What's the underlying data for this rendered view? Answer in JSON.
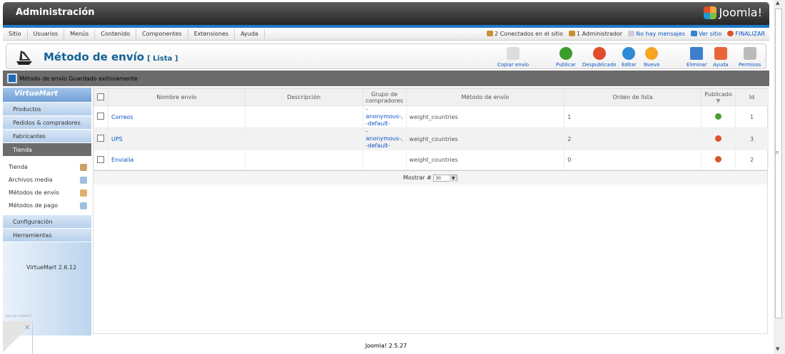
{
  "header": {
    "title": "Administración",
    "brand": "Joomla!"
  },
  "menu": [
    "Sitio",
    "Usuarios",
    "Menús",
    "Contenido",
    "Componentes",
    "Extensiones",
    "Ayuda"
  ],
  "status": {
    "online": "2 Conectados en el sitio",
    "admins": "1 Administrador",
    "messages": "No hay mensajes",
    "view_site": "Ver sitio",
    "logout": "FINALIZAR"
  },
  "page": {
    "title": "Método de envío",
    "subtitle": "[ Lista ]"
  },
  "toolbar": {
    "copy": "Copiar envío",
    "publish": "Publicar",
    "unpublish": "Despublicado",
    "edit": "Editar",
    "new": "Nuevo",
    "delete": "Eliminar",
    "help": "Ayuda",
    "permissions": "Permisos"
  },
  "message": "Método de envío Guardado exitosamente",
  "sidebar": {
    "logo": "VirtueMart",
    "sections": [
      "Productos",
      "Pedidos & compradores",
      "Fabricantes",
      "Tienda"
    ],
    "items": [
      "Tienda",
      "Archivos media",
      "Métodos de envío",
      "Métodos de pago"
    ],
    "sections2": [
      "Configuración",
      "Herramientas"
    ],
    "version": "VirtueMart 2.6.12",
    "built_by": "Joo by iceberit"
  },
  "table": {
    "headers": {
      "name": "Nombre envío",
      "description": "Descripción",
      "group": "Grupo de compradores",
      "method": "Método de envío",
      "order": "Orden de lista",
      "published": "Publicado",
      "id": "Id"
    },
    "rows": [
      {
        "name": "Correos",
        "description": "",
        "group1": "-anonymous-,",
        "group2": "-default-",
        "method": "weight_countries",
        "order": "1",
        "published": true,
        "id": "1"
      },
      {
        "name": "UPS",
        "description": "",
        "group1": "-anonymous-,",
        "group2": "-default-",
        "method": "weight_countries",
        "order": "2",
        "published": false,
        "id": "3"
      },
      {
        "name": "Envialia",
        "description": "",
        "group1": "",
        "group2": "",
        "method": "weight_countries",
        "order": "0",
        "published": false,
        "id": "2"
      }
    ]
  },
  "pager": {
    "label": "Mostrar #",
    "value": "30"
  },
  "footer": "Joomla! 2.5.27"
}
